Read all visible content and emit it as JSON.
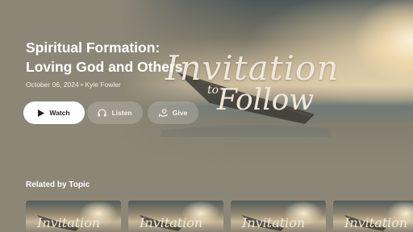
{
  "hero": {
    "title_line1": "Spiritual Formation:",
    "title_line2": "Loving God and Others",
    "meta": "October 06, 2024 • Kyle Fowler",
    "art": {
      "line1": "Invitation",
      "line2": "to",
      "line3": "Follow"
    }
  },
  "actions": {
    "watch_label": "Watch",
    "listen_label": "Listen",
    "give_label": "Give"
  },
  "related": {
    "heading": "Related by Topic",
    "items": [
      {
        "logo": "Invitation"
      },
      {
        "logo": "Invitation"
      },
      {
        "logo": "Invitation"
      },
      {
        "logo": "Invitation"
      }
    ]
  },
  "icons": {
    "watch": "play-icon",
    "listen": "headphones-icon",
    "give": "give-hand-icon"
  },
  "colors": {
    "background": "#8c8676",
    "primary_button": "#ffffff",
    "secondary_button": "rgba(255,255,255,0.18)"
  }
}
